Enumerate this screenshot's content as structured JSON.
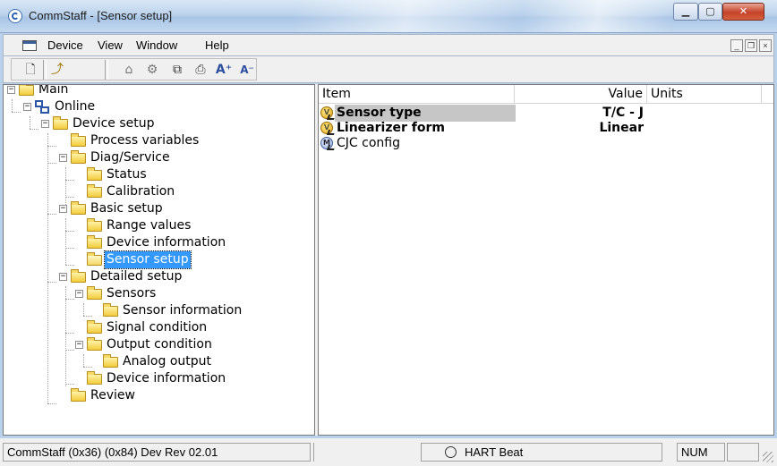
{
  "window": {
    "title": "CommStaff - [Sensor setup]"
  },
  "menu": {
    "items": [
      "Device",
      "View",
      "Window",
      "Help"
    ]
  },
  "toolbar": {
    "icons": [
      "new-document-icon",
      "help-pointer-icon",
      "device-icon",
      "tools-icon",
      "copy-icon",
      "print-icon",
      "font-increase-icon",
      "font-decrease-icon"
    ]
  },
  "tree": {
    "nodes": [
      {
        "label": "Main",
        "icon": "folder",
        "expander": "⊟"
      },
      {
        "label": "Online",
        "icon": "online",
        "expander": "⊟"
      },
      {
        "label": "Device setup",
        "icon": "folder",
        "expander": "⊟"
      },
      {
        "label": "Process variables",
        "icon": "folder"
      },
      {
        "label": "Diag/Service",
        "icon": "folder",
        "expander": "⊟"
      },
      {
        "label": "Status",
        "icon": "folder"
      },
      {
        "label": "Calibration",
        "icon": "folder"
      },
      {
        "label": "Basic setup",
        "icon": "folder",
        "expander": "⊟"
      },
      {
        "label": "Range values",
        "icon": "folder"
      },
      {
        "label": "Device information",
        "icon": "folder"
      },
      {
        "label": "Sensor setup",
        "icon": "folder-open",
        "selected": true
      },
      {
        "label": "Detailed setup",
        "icon": "folder",
        "expander": "⊟"
      },
      {
        "label": "Sensors",
        "icon": "folder",
        "expander": "⊟"
      },
      {
        "label": "Sensor information",
        "icon": "folder"
      },
      {
        "label": "Signal condition",
        "icon": "folder"
      },
      {
        "label": "Output condition",
        "icon": "folder",
        "expander": "⊟"
      },
      {
        "label": "Analog output",
        "icon": "folder"
      },
      {
        "label": "Device information",
        "icon": "folder"
      },
      {
        "label": "Review",
        "icon": "folder"
      }
    ]
  },
  "list": {
    "columns": [
      "Item",
      "Value",
      "Units"
    ],
    "rows": [
      {
        "item": "Sensor type",
        "value": "T/C - J",
        "units": "",
        "icon": "V",
        "bold": true,
        "selected": true
      },
      {
        "item": "Linearizer form",
        "value": "Linear",
        "units": "",
        "icon": "V",
        "bold": true
      },
      {
        "item": "CJC config",
        "value": "",
        "units": "",
        "icon": "M",
        "bold": false
      }
    ]
  },
  "status": {
    "device": "CommStaff  (0x36)  (0x84) Dev Rev 02.01",
    "heartbeat": "HART Beat",
    "num": "NUM"
  }
}
